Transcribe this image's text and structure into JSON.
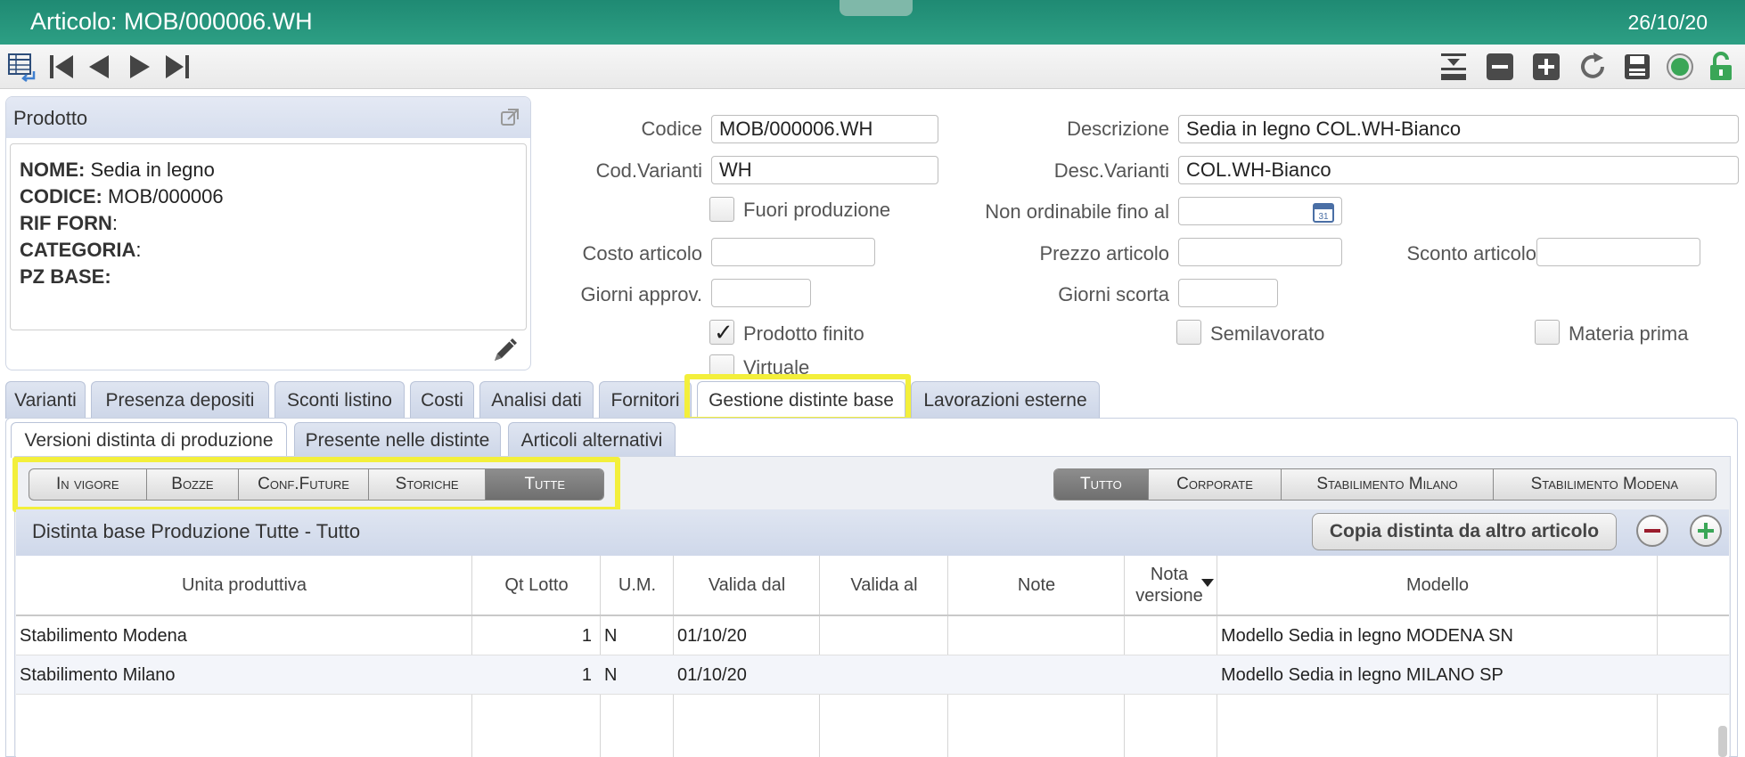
{
  "header": {
    "title": "Articolo: MOB/000006.WH",
    "date": "26/10/20"
  },
  "toolbar": {
    "left_icons": [
      "table-return-icon",
      "first-record-icon",
      "prev-record-icon",
      "next-record-icon",
      "last-record-icon"
    ],
    "right_icons": [
      "collapse-icon",
      "minus-icon",
      "plus-icon",
      "refresh-icon",
      "save-icon",
      "status-green-icon",
      "unlock-icon"
    ]
  },
  "product": {
    "title": "Prodotto",
    "lines": [
      {
        "key": "NOME:",
        "value": " Sedia in legno"
      },
      {
        "key": "CODICE:",
        "value": " MOB/000006"
      },
      {
        "key": "RIF FORN",
        "value": ":"
      },
      {
        "key": "CATEGORIA",
        "value": ":"
      },
      {
        "key": "PZ BASE:",
        "value": ""
      }
    ]
  },
  "form": {
    "codice_label": "Codice",
    "codice_value": "MOB/000006.WH",
    "descrizione_label": "Descrizione",
    "descrizione_value": "Sedia in legno COL.WH-Bianco",
    "cod_varianti_label": "Cod.Varianti",
    "cod_varianti_value": "WH",
    "desc_varianti_label": "Desc.Varianti",
    "desc_varianti_value": "COL.WH-Bianco",
    "fuori_produzione_label": "Fuori produzione",
    "non_ordinabile_label": "Non ordinabile fino al",
    "non_ordinabile_value": "",
    "costo_label": "Costo articolo",
    "costo_value": "",
    "prezzo_label": "Prezzo articolo",
    "prezzo_value": "",
    "sconto_label": "Sconto articolo",
    "sconto_value": "",
    "giorni_approv_label": "Giorni approv.",
    "giorni_approv_value": "",
    "giorni_scorta_label": "Giorni scorta",
    "giorni_scorta_value": "",
    "prodotto_finito_label": "Prodotto finito",
    "semilavorato_label": "Semilavorato",
    "materia_prima_label": "Materia prima",
    "virtuale_label": "Virtuale"
  },
  "tabs": [
    "Varianti",
    "Presenza depositi",
    "Sconti listino",
    "Costi",
    "Analisi dati",
    "Fornitori",
    "Gestione distinte base",
    "Lavorazioni esterne"
  ],
  "subtabs": [
    "Versioni distinta di produzione",
    "Presente nelle distinte",
    "Articoli alternativi"
  ],
  "filter_state": [
    "In vigore",
    "Bozze",
    "Conf.Future",
    "Storiche",
    "Tutte"
  ],
  "filter_site": [
    "Tutto",
    "Corporate",
    "Stabilimento Milano",
    "Stabilimento Modena"
  ],
  "grid": {
    "title": "Distinta base Produzione Tutte - Tutto",
    "copy_button": "Copia distinta da altro articolo",
    "columns": [
      "Unita produttiva",
      "Qt Lotto",
      "U.M.",
      "Valida dal",
      "Valida al",
      "Note",
      "Nota versione",
      "Modello"
    ],
    "rows": [
      [
        "Stabilimento Modena",
        "1",
        "N",
        "01/10/20",
        "",
        "",
        "",
        "Modello Sedia in legno MODENA SN"
      ],
      [
        "Stabilimento Milano",
        "1",
        "N",
        "01/10/20",
        "",
        "",
        "",
        "Modello Sedia in legno MILANO SP"
      ]
    ]
  }
}
